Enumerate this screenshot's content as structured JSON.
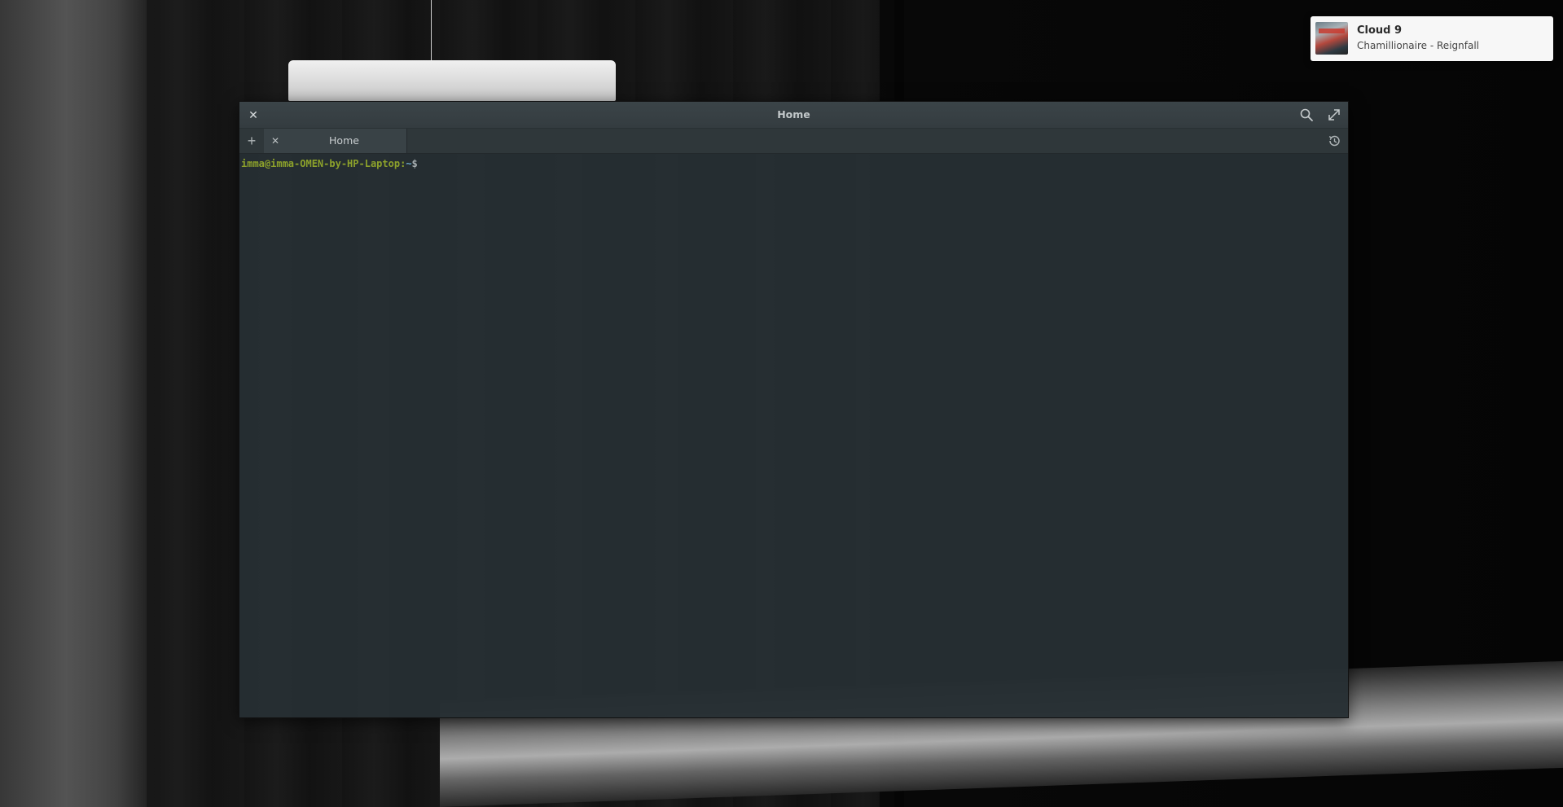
{
  "window": {
    "title": "Home",
    "close_icon": "close-icon",
    "search_icon": "search-icon",
    "maximize_icon": "maximize-icon"
  },
  "tabs": {
    "new_tab_icon": "plus-icon",
    "items": [
      {
        "label": "Home",
        "active": true
      }
    ],
    "history_icon": "history-icon"
  },
  "terminal": {
    "user_host": "imma@imma-OMEN-by-HP-Laptop",
    "separator": ":",
    "path": "~",
    "dollar": "$"
  },
  "notification": {
    "title": "Cloud 9",
    "body": "Chamillionaire - Reignfall",
    "icon": "album-art"
  },
  "colors": {
    "prompt_user": "#8da22b",
    "prompt_path": "#6aa6c8",
    "terminal_bg": "#262f33",
    "notification_bg": "#f7f7f7"
  }
}
